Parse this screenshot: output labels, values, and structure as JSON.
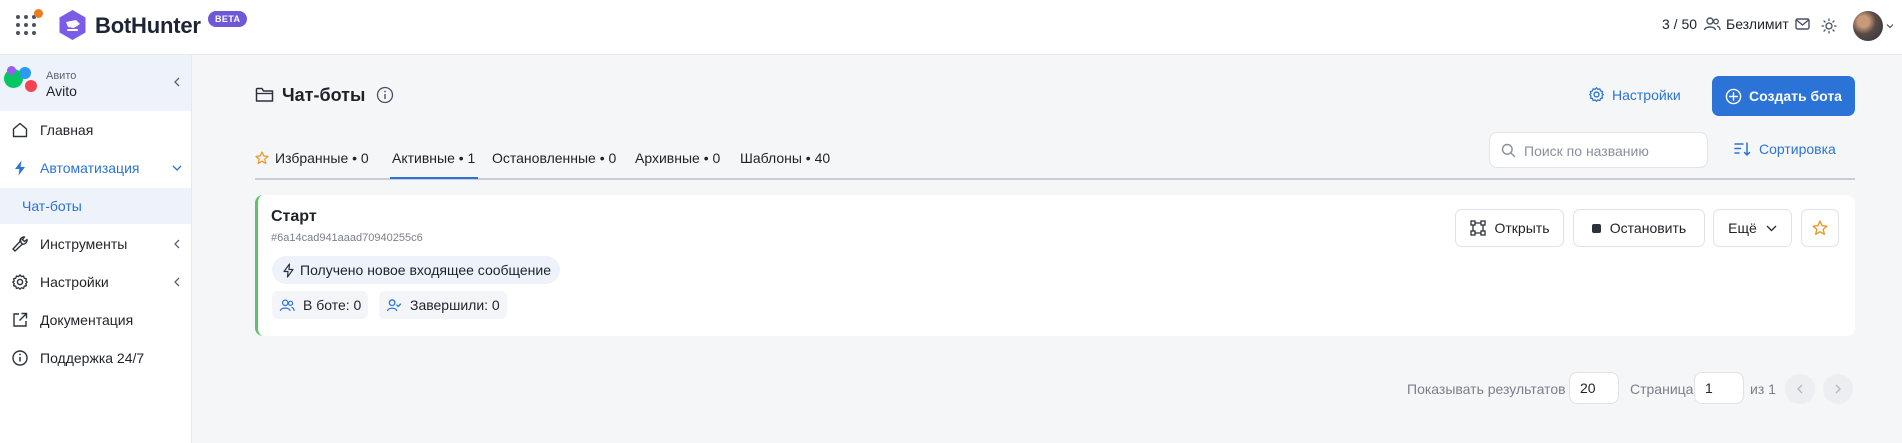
{
  "header": {
    "app_name": "BotHunter",
    "badge": "BETA",
    "usage": "3 / 50",
    "plan": "Безлимит"
  },
  "sidebar": {
    "account": {
      "platform": "Авито",
      "name": "Avito"
    },
    "items": [
      {
        "label": "Главная",
        "icon": "home-icon"
      },
      {
        "label": "Автоматизация",
        "icon": "lightning-icon"
      },
      {
        "label": "Чат-боты",
        "icon": ""
      },
      {
        "label": "Инструменты",
        "icon": "wrench-icon"
      },
      {
        "label": "Настройки",
        "icon": "gear-icon"
      },
      {
        "label": "Документация",
        "icon": "external-link-icon"
      },
      {
        "label": "Поддержка 24/7",
        "icon": "info-icon"
      }
    ]
  },
  "main": {
    "title": "Чат-боты",
    "settings_label": "Настройки",
    "create_label": "Создать бота",
    "tabs": [
      {
        "label": "Избранные • 0"
      },
      {
        "label": "Активные • 1"
      },
      {
        "label": "Остановленные • 0"
      },
      {
        "label": "Архивные • 0"
      },
      {
        "label": "Шаблоны • 40"
      }
    ],
    "search_placeholder": "Поиск по названию",
    "sort_label": "Сортировка"
  },
  "bot": {
    "name": "Старт",
    "id": "#6a14cad941aaad70940255c6",
    "trigger": "Получено новое входящее сообщение",
    "in_bot": "В боте: 0",
    "finished": "Завершили: 0",
    "open_label": "Открыть",
    "stop_label": "Остановить",
    "more_label": "Ещё"
  },
  "pagination": {
    "per_page_label": "Показывать результатов",
    "per_page": "20",
    "page_label": "Страница",
    "page": "1",
    "of_label": "из 1"
  },
  "colors": {
    "accent": "#2b73d6",
    "brand": "#6f58d8",
    "active_border": "#5ac466",
    "favorite_star": "#f0961e"
  }
}
